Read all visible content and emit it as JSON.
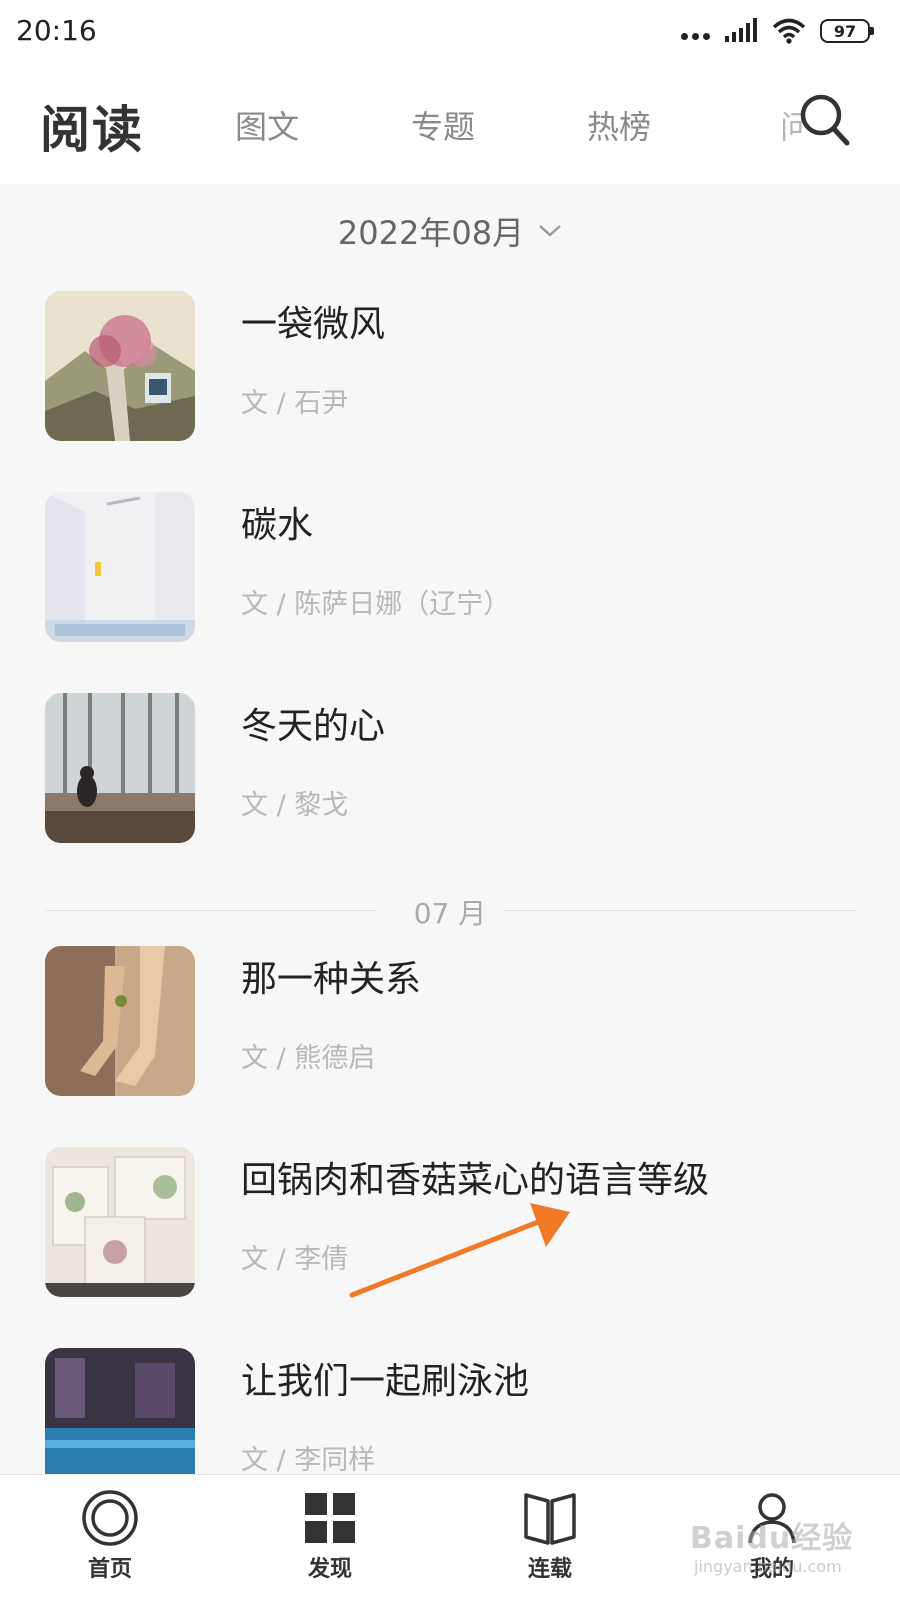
{
  "status_bar": {
    "time": "20:16",
    "battery": "97"
  },
  "header": {
    "title": "阅读",
    "tabs": [
      "图文",
      "专题",
      "热榜"
    ],
    "clipped_tab": "问答"
  },
  "month_picker": {
    "label": "2022年08月"
  },
  "articles_aug": [
    {
      "title": "一袋微风",
      "author": "文 / 石尹"
    },
    {
      "title": "碳水",
      "author": "文 / 陈萨日娜（辽宁）"
    },
    {
      "title": "冬天的心",
      "author": "文 / 黎戈"
    }
  ],
  "divider": {
    "label": "07 月"
  },
  "articles_jul": [
    {
      "title": "那一种关系",
      "author": "文 / 熊德启"
    },
    {
      "title": "回锅肉和香菇菜心的语言等级",
      "author": "文 / 李倩"
    },
    {
      "title": "让我们一起刷泳池",
      "author": "文 / 李同样"
    }
  ],
  "bottom_nav": [
    {
      "label": "首页",
      "icon": "home-ring-icon"
    },
    {
      "label": "发现",
      "icon": "grid-icon"
    },
    {
      "label": "连载",
      "icon": "book-icon"
    },
    {
      "label": "我的",
      "icon": "person-icon"
    }
  ],
  "watermark": {
    "text": "Baidu经验",
    "sub": "jingyan.baidu.com"
  },
  "colors": {
    "annotation_arrow": "#f07a28"
  }
}
